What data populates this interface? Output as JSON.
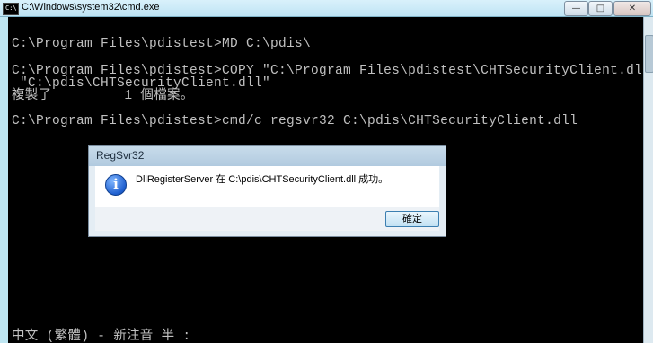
{
  "window": {
    "title": "C:\\Windows\\system32\\cmd.exe",
    "icon_text": "C:\\",
    "minimize_glyph": "—",
    "maximize_glyph": "□",
    "close_glyph": "✕"
  },
  "console": {
    "lines": [
      "C:\\Program Files\\pdistest>MD C:\\pdis\\",
      "C:\\Program Files\\pdistest>COPY \"C:\\Program Files\\pdistest\\CHTSecurityClient.dll\"",
      " \"C:\\pdis\\CHTSecurityClient.dll\"",
      "複製了         1 個檔案。",
      "C:\\Program Files\\pdistest>cmd/c regsvr32 C:\\pdis\\CHTSecurityClient.dll",
      "中文 (繁體) - 新注音 半 :"
    ]
  },
  "dialog": {
    "title": "RegSvr32",
    "icon": "info-icon",
    "message": "DllRegisterServer 在 C:\\pdis\\CHTSecurityClient.dll 成功。",
    "ok_label": "確定"
  }
}
